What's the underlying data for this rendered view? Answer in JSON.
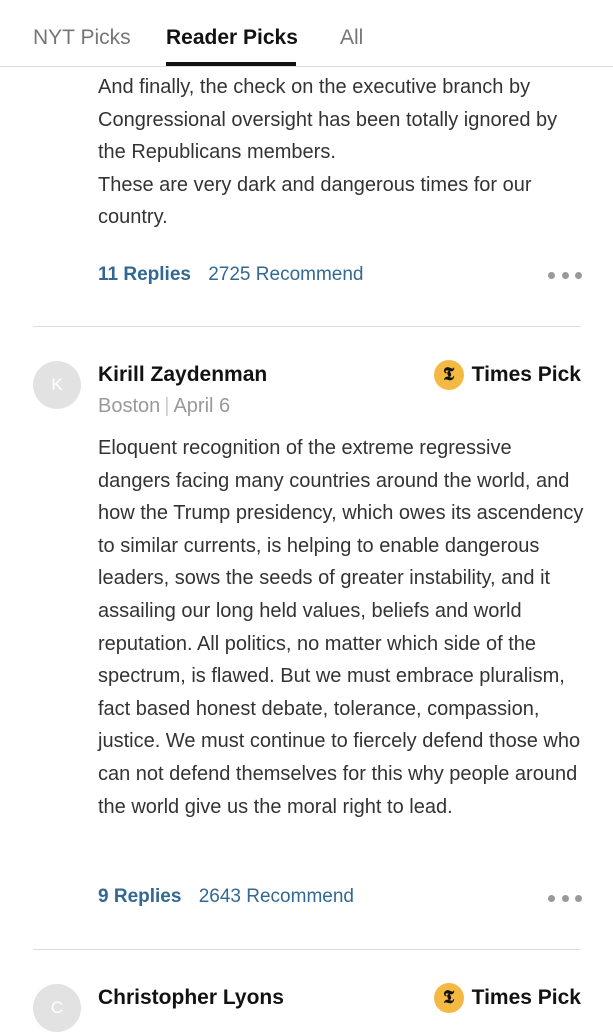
{
  "tabs": [
    {
      "label": "NYT Picks"
    },
    {
      "label": "Reader Picks"
    },
    {
      "label": "All"
    }
  ],
  "comments": [
    {
      "paragraphs": [
        "And finally, the check on the executive branch by Congressional oversight has been totally ignored by the Republicans members.",
        "These are very dark and dangerous times for our country."
      ],
      "replies": "11 Replies",
      "recommend": "2725 Recommend"
    },
    {
      "avatar_letter": "K",
      "author": "Kirill Zaydenman",
      "location": "Boston",
      "date": "April 6",
      "badge_glyph": "𝕿",
      "badge_label": "Times Pick",
      "body": "Eloquent recognition of the extreme regressive dangers facing many countries around the world, and how the Trump presidency, which owes its ascendency to similar currents, is helping to enable dangerous leaders, sows the seeds of greater instability, and it assailing our long held values, beliefs and world reputation. All politics, no matter which side of the spectrum, is flawed. But we must embrace pluralism, fact based honest debate, tolerance, compassion, justice. We must continue to fiercely defend those who can not defend themselves for this why people around the world give us the moral right to lead.",
      "replies": "9 Replies",
      "recommend": "2643 Recommend"
    },
    {
      "avatar_letter": "C",
      "author": "Christopher Lyons",
      "badge_glyph": "𝕿",
      "badge_label": "Times Pick"
    }
  ],
  "colors": {
    "link": "#326891",
    "badge": "#f4b942",
    "divider": "#dcdcdc"
  }
}
